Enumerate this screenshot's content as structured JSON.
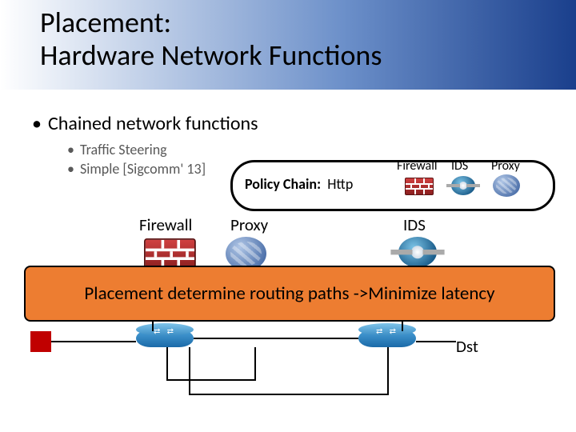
{
  "title": {
    "line1": "Placement:",
    "line2": "Hardware Network Functions"
  },
  "bullets": {
    "l1": "Chained network functions",
    "l2a": "Traffic Steering",
    "l2b": "Simple [Sigcomm' 13]"
  },
  "policy": {
    "label_prefix": "Policy Chain:",
    "proto": "Http",
    "fw": "Firewall",
    "ids": "IDS",
    "proxy": "Proxy"
  },
  "nodes": {
    "firewall": "Firewall",
    "proxy": "Proxy",
    "ids": "IDS",
    "dst": "Dst"
  },
  "banner": "Placement determine routing paths ->Minimize latency"
}
